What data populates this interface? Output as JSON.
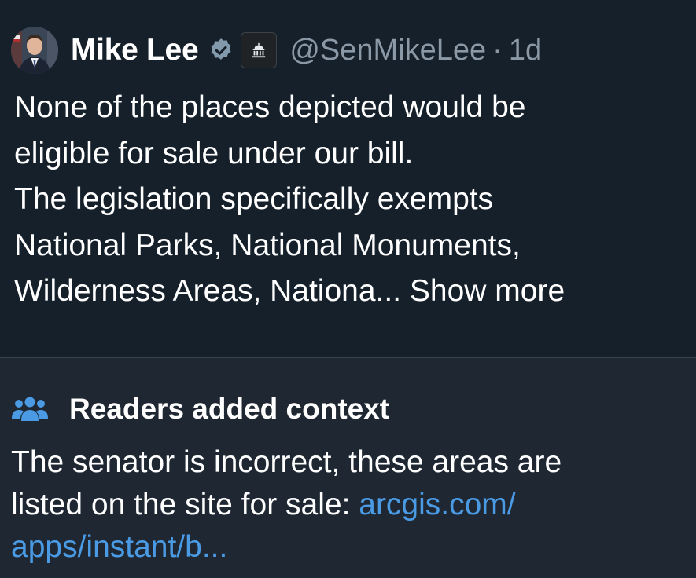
{
  "tweet": {
    "author": {
      "name": "Mike Lee",
      "handle": "@SenMikeLee",
      "separator": "·",
      "time": "1d",
      "avatar_icon": "senator-portrait-avatar",
      "verified_icon": "verified-badge-icon",
      "affiliation_icon": "government-building-icon"
    },
    "text_lines": [
      "None of the places depicted would be",
      "eligible for sale under our bill.",
      "The legislation specifically exempts",
      "National Parks, National Monuments,",
      "Wilderness Areas, Nationa..."
    ],
    "show_more": "Show more"
  },
  "community_note": {
    "icon": "people-icon",
    "title": "Readers added context",
    "text_line1": "The senator is incorrect, these areas are",
    "text_line2_prefix": "listed on the site for sale: ",
    "link_part1": "arcgis.com/",
    "link_part2": "apps/instant/b..."
  },
  "colors": {
    "background": "#15202b",
    "note_background": "#1e2732",
    "secondary_text": "#8b98a5",
    "link": "#4a9ae4",
    "verified": "#829aab"
  }
}
